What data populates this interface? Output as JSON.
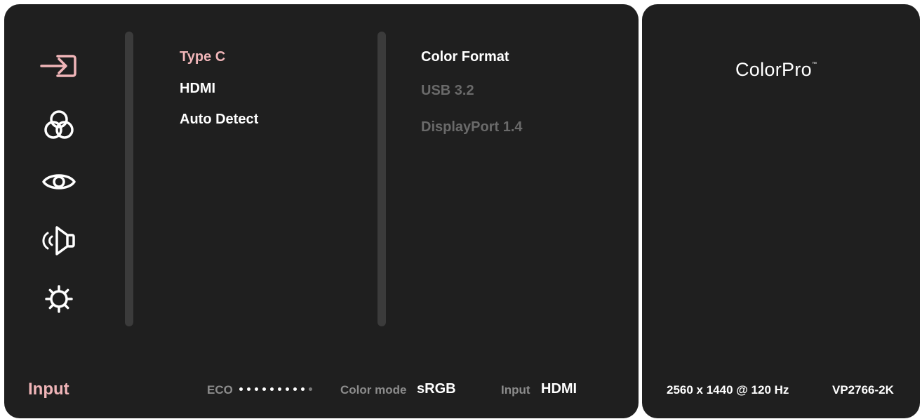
{
  "sidebar": {
    "icons": [
      {
        "name": "input-icon",
        "selected": true
      },
      {
        "name": "color-adjust-icon",
        "selected": false
      },
      {
        "name": "view-mode-icon",
        "selected": false
      },
      {
        "name": "audio-icon",
        "selected": false
      },
      {
        "name": "setup-gear-icon",
        "selected": false
      }
    ]
  },
  "submenu": {
    "items": [
      {
        "label": "Type C",
        "state": "selected"
      },
      {
        "label": "HDMI",
        "state": "normal"
      },
      {
        "label": "Auto Detect",
        "state": "normal"
      }
    ]
  },
  "options": {
    "items": [
      {
        "label": "Color Format",
        "state": "normal"
      },
      {
        "label": "USB 3.2",
        "state": "disabled"
      },
      {
        "label": "DisplayPort 1.4",
        "state": "disabled"
      }
    ]
  },
  "footer": {
    "page_title": "Input",
    "eco_label": "ECO",
    "eco_level": 9,
    "eco_max": 10,
    "color_mode_label": "Color mode",
    "color_mode_value": "sRGB",
    "input_label": "Input",
    "input_value": "HDMI"
  },
  "info": {
    "brand_name": "ColorPro",
    "brand_mark": "™",
    "resolution": "2560 x 1440 @ 120 Hz",
    "model": "VP2766-2K"
  },
  "colors": {
    "accent": "#f0b5b8",
    "panel_bg": "#1f1f1f",
    "text": "#ffffff",
    "disabled": "#6a6a6a"
  }
}
